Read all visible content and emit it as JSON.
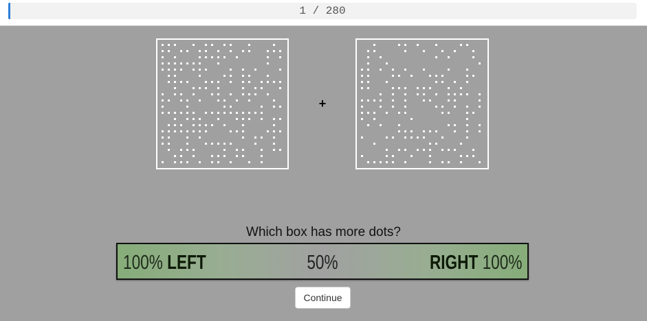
{
  "progress": {
    "text": "1 / 280",
    "current": 1,
    "total": 280,
    "fill_color": "#2f7fd8"
  },
  "fixation": {
    "symbol": "+"
  },
  "stimulus": {
    "left_box_dots": 210,
    "right_box_dots": 160,
    "dot_color": "#ffffff",
    "background_color": "#a0a0a0"
  },
  "question": "Which box has more dots?",
  "scale": {
    "left_pct": "100%",
    "left_word": "LEFT",
    "middle": "50%",
    "right_word": "RIGHT",
    "right_pct": "100%",
    "end_color": "#86ad79",
    "middle_color": "#a1a1a1"
  },
  "continue_label": "Continue"
}
